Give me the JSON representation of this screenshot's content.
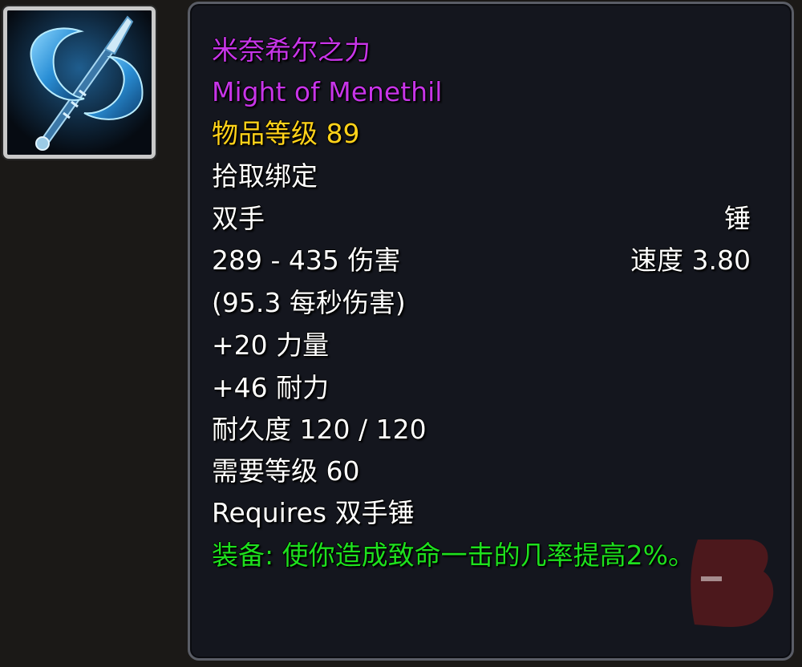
{
  "item": {
    "name_cn": "米奈希尔之力",
    "name_en": "Might of Menethil",
    "item_level": "物品等级 89",
    "binding": "拾取绑定",
    "slot": "双手",
    "weapon_type": "锤",
    "damage": "289 - 435 伤害",
    "speed": "速度 3.80",
    "dps": "(95.3 每秒伤害)",
    "stat_strength": "+20 力量",
    "stat_stamina": "+46 耐力",
    "durability": "耐久度 120 / 120",
    "required_level": "需要等级 60",
    "requires_skill": "Requires 双手锤",
    "equip_effect": "装备: 使你造成致命一击的几率提高2%。"
  },
  "colors": {
    "epic": "#c735e8",
    "item_level": "#ffd21a",
    "equip_effect": "#1ee01e",
    "text": "#ffffff"
  },
  "icon": {
    "name": "two-handed-mace-icon"
  }
}
